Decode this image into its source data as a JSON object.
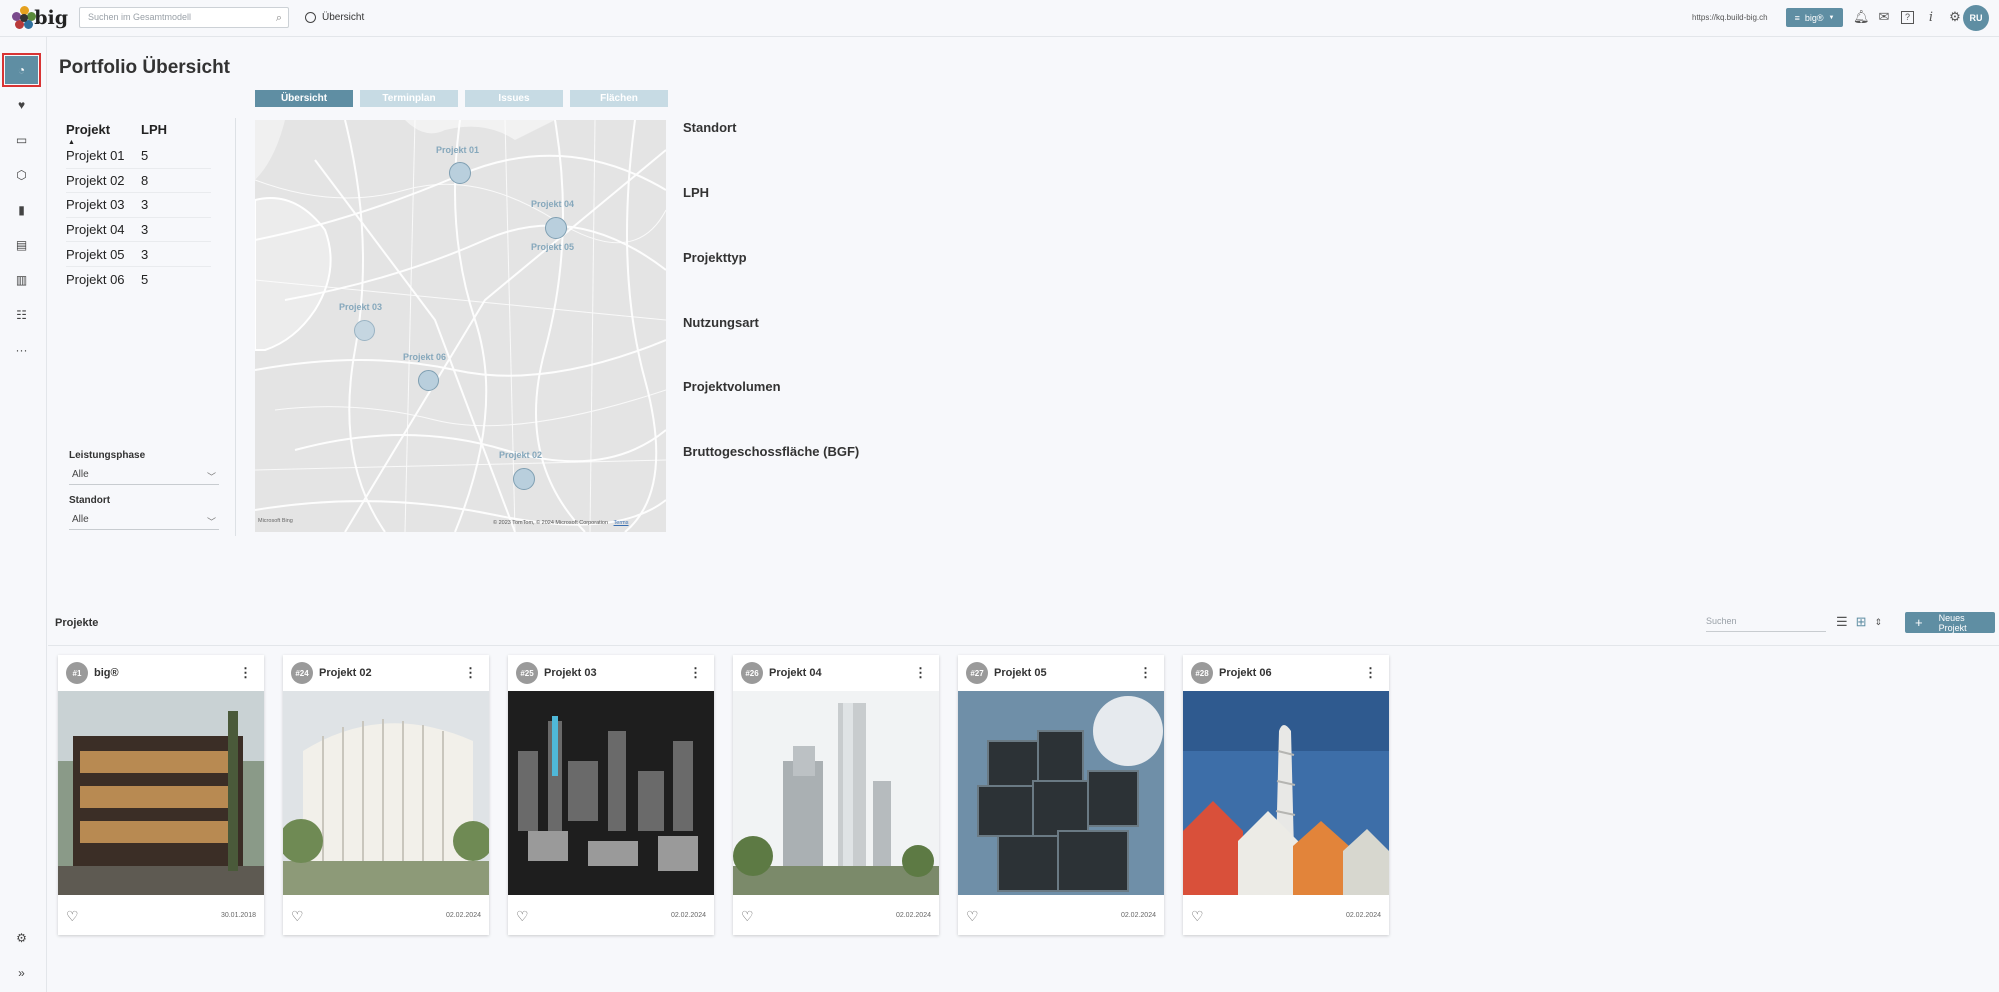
{
  "app": {
    "logo_text": "big"
  },
  "topbar": {
    "search_placeholder": "Suchen im Gesamtmodell",
    "breadcrumb": "Übersicht",
    "url": "https://kq.build-big.ch",
    "workspace_button": "big®",
    "avatar_initials": "RU"
  },
  "sidebar": {
    "items": [
      {
        "icon": "dashboard-icon",
        "glyph": "◔"
      },
      {
        "icon": "heart-icon",
        "glyph": "♥"
      },
      {
        "icon": "folder-icon",
        "glyph": "▭"
      },
      {
        "icon": "cube-icon",
        "glyph": "⬡"
      },
      {
        "icon": "bar-chart-icon",
        "glyph": "▮"
      },
      {
        "icon": "clipboard-icon",
        "glyph": "▤"
      },
      {
        "icon": "buildings-icon",
        "glyph": "▥"
      },
      {
        "icon": "checklist-icon",
        "glyph": "☷"
      },
      {
        "icon": "more-icon",
        "glyph": "···"
      }
    ],
    "settings_glyph": "⚙",
    "expand_glyph": "»"
  },
  "page": {
    "title": "Portfolio Übersicht",
    "tabs": [
      "Übersicht",
      "Terminplan",
      "Issues",
      "Flächen"
    ],
    "table_headers": {
      "project": "Projekt",
      "phase": "LPH"
    },
    "rows": [
      {
        "name": "Projekt 01",
        "lph": "5"
      },
      {
        "name": "Projekt 02",
        "lph": "8"
      },
      {
        "name": "Projekt 03",
        "lph": "3"
      },
      {
        "name": "Projekt 04",
        "lph": "3"
      },
      {
        "name": "Projekt 05",
        "lph": "3"
      },
      {
        "name": "Projekt 06",
        "lph": "5"
      }
    ],
    "filters": [
      {
        "label": "Leistungsphase",
        "value": "Alle"
      },
      {
        "label": "Standort",
        "value": "Alle"
      }
    ],
    "map": {
      "markers": [
        {
          "label": "Projekt 01"
        },
        {
          "label": "Projekt 04"
        },
        {
          "label": "Projekt 05"
        },
        {
          "label": "Projekt 03"
        },
        {
          "label": "Projekt 06"
        },
        {
          "label": "Projekt 02"
        }
      ],
      "attribution": "© 2023 TomTom, © 2024 Microsoft Corporation",
      "terms": "Terms",
      "provider": "Microsoft Bing"
    },
    "kpis": [
      "Standort",
      "LPH",
      "Projekttyp",
      "Nutzungsart",
      "Projektvolumen",
      "Bruttogeschossfläche (BGF)"
    ]
  },
  "projects": {
    "heading": "Projekte",
    "search_placeholder": "Suchen",
    "new_button": "Neues Projekt",
    "new_button_glyph": "+",
    "cards": [
      {
        "badge": "#1",
        "name": "big®",
        "date": "30.01.2018"
      },
      {
        "badge": "#24",
        "name": "Projekt 02",
        "date": "02.02.2024"
      },
      {
        "badge": "#25",
        "name": "Projekt 03",
        "date": "02.02.2024"
      },
      {
        "badge": "#26",
        "name": "Projekt 04",
        "date": "02.02.2024"
      },
      {
        "badge": "#27",
        "name": "Projekt 05",
        "date": "02.02.2024"
      },
      {
        "badge": "#28",
        "name": "Projekt 06",
        "date": "02.02.2024"
      }
    ]
  },
  "colors": {
    "accent": "#5f8ea3",
    "accent_light": "#c7dbe4",
    "highlight": "#d83434"
  }
}
